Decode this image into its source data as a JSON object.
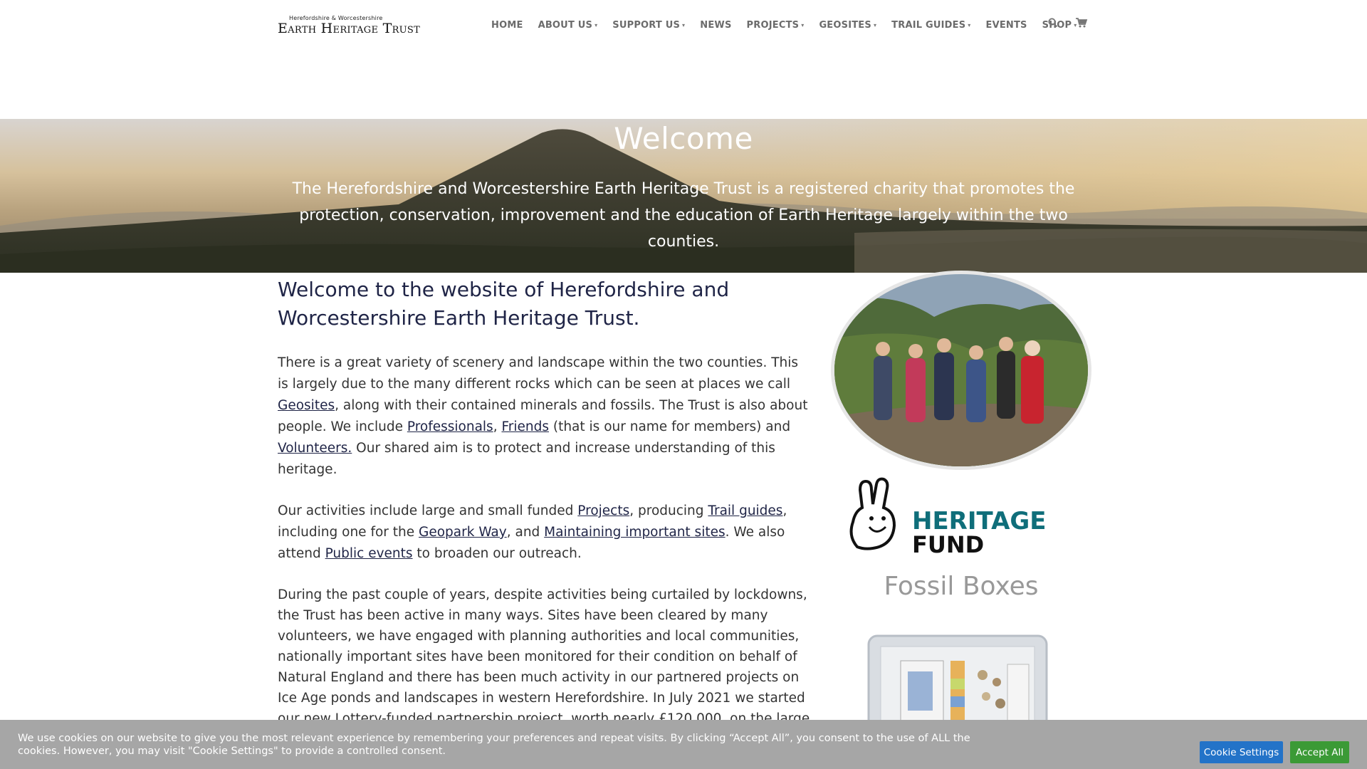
{
  "header": {
    "logo_sup": "Herefordshire & Worcestershire",
    "logo_main": "Earth Heritage Trust",
    "nav": [
      {
        "label": "HOME",
        "has_dropdown": false
      },
      {
        "label": "ABOUT US",
        "has_dropdown": true
      },
      {
        "label": "SUPPORT US",
        "has_dropdown": true
      },
      {
        "label": "NEWS",
        "has_dropdown": false
      },
      {
        "label": "PROJECTS",
        "has_dropdown": true
      },
      {
        "label": "GEOSITES",
        "has_dropdown": true
      },
      {
        "label": "TRAIL GUIDES",
        "has_dropdown": true
      },
      {
        "label": "EVENTS",
        "has_dropdown": false
      },
      {
        "label": "SHOP",
        "has_dropdown": true
      }
    ],
    "search_icon": "search-icon",
    "cart_icon": "cart-icon"
  },
  "hero": {
    "title": "Welcome",
    "text": "The Herefordshire and Worcestershire Earth Heritage Trust is a registered charity that promotes the protection, conservation, improvement and the education of Earth Heritage largely within the two counties."
  },
  "main": {
    "heading": "Welcome to the website of Herefordshire and Worcestershire Earth Heritage Trust.",
    "p1": {
      "t1": "There is a great variety of scenery and landscape within the two counties. This is largely due to the many different rocks which can be seen at places we call ",
      "link_geosites": "Geosites",
      "t2": ", along with their contained minerals and fossils. The Trust is also about people. We include ",
      "link_professionals": "Professionals",
      "t3": ", ",
      "link_friends": "Friends",
      "t4": " (that is our name for members) and ",
      "link_volunteers": "Volunteers.",
      "t5": " Our shared aim is to protect and increase understanding of this heritage."
    },
    "p2": {
      "t1": "Our activities include large and small funded ",
      "link_projects": "Projects",
      "t2": ", producing ",
      "link_trail_guides": "Trail guides",
      "t3": ", including one for the ",
      "link_geopark_way": "Geopark Way",
      "t4": ", and ",
      "link_maintaining": "Maintaining important sites",
      "t5": ". We also attend ",
      "link_public_events": "Public events",
      "t6": " to broaden our outreach."
    },
    "p3": "During the past couple of years, despite activities being curtailed by lockdowns, the Trust has been active in many ways.  Sites have been cleared by many volunteers, we have engaged with planning authorities and local communities, nationally important sites have been monitored for their condition on behalf of Natural England and there has been much activity in our partnered projects on Ice Age ponds and landscapes in western Herefordshire.  In July 2021 we started our new Lottery-funded partnership project, worth nearly £120,000, on the large glacial erratics in Birmingham and NE Worcestershire."
  },
  "sidebar": {
    "heritage_fund_line1": "HERITAGE",
    "heritage_fund_line2": "FUND",
    "fossil_title": "Fossil Boxes"
  },
  "cookie": {
    "text": "We use cookies on our website to give you the most relevant experience by remembering your preferences and repeat visits. By clicking “Accept All”, you consent to the use of ALL the cookies. However, you may visit \"Cookie Settings\" to provide a controlled consent.",
    "settings_label": "Cookie Settings",
    "accept_label": "Accept All"
  },
  "colors": {
    "nav_text": "#6b6b6b",
    "heading": "#1f2446",
    "heritage_teal": "#0f6e7a",
    "cookie_bar": "#a6a6a6",
    "settings_button": "#2373c8",
    "accept_button": "#3b9a36"
  }
}
